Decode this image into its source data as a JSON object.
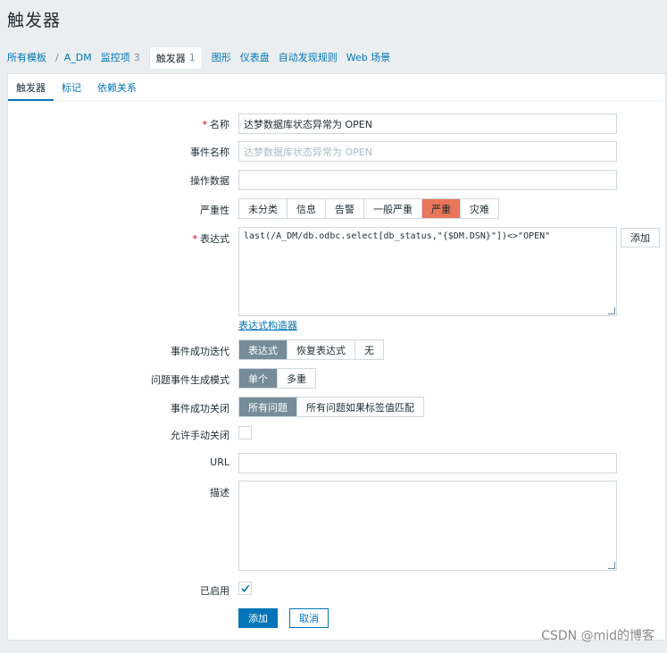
{
  "page": {
    "title": "触发器"
  },
  "breadcrumb": {
    "all_templates": "所有模板",
    "template": "A_DM",
    "items": "监控项",
    "items_count": "3",
    "triggers": "触发器",
    "triggers_count": "1",
    "graphs": "图形",
    "dashboards": "仪表盘",
    "discovery": "自动发现规则",
    "web": "Web 场景"
  },
  "tabs": [
    "触发器",
    "标记",
    "依赖关系"
  ],
  "form": {
    "name": {
      "label": "名称",
      "value": "达梦数据库状态异常为 OPEN"
    },
    "event_name": {
      "label": "事件名称",
      "placeholder": "达梦数据库状态异常为 OPEN"
    },
    "opdata": {
      "label": "操作数据",
      "value": ""
    },
    "severity": {
      "label": "严重性",
      "options": [
        "未分类",
        "信息",
        "告警",
        "一般严重",
        "严重",
        "灾难"
      ],
      "selected": "严重"
    },
    "expression": {
      "label": "表达式",
      "value": "last(/A_DM/db.odbc.select[db_status,\"{$DM.DSN}\"])<>\"OPEN\"",
      "add": "添加",
      "builder": "表达式构造器"
    },
    "recovery_mode": {
      "label": "事件成功迭代",
      "options": [
        "表达式",
        "恢复表达式",
        "无"
      ],
      "selected": "表达式"
    },
    "problem_mode": {
      "label": "问题事件生成模式",
      "options": [
        "单个",
        "多重"
      ],
      "selected": "单个"
    },
    "ok_close": {
      "label": "事件成功关闭",
      "options": [
        "所有问题",
        "所有问题如果标签值匹配"
      ],
      "selected": "所有问题"
    },
    "manual_close": {
      "label": "允许手动关闭",
      "checked": false
    },
    "url": {
      "label": "URL",
      "value": ""
    },
    "description": {
      "label": "描述",
      "value": ""
    },
    "enabled": {
      "label": "已启用",
      "checked": true
    }
  },
  "actions": {
    "add": "添加",
    "cancel": "取消"
  },
  "watermark": "CSDN @mid的博客",
  "colors": {
    "accent": "#0275b8",
    "severity_high": "#e97659",
    "selected": "#768d99"
  }
}
